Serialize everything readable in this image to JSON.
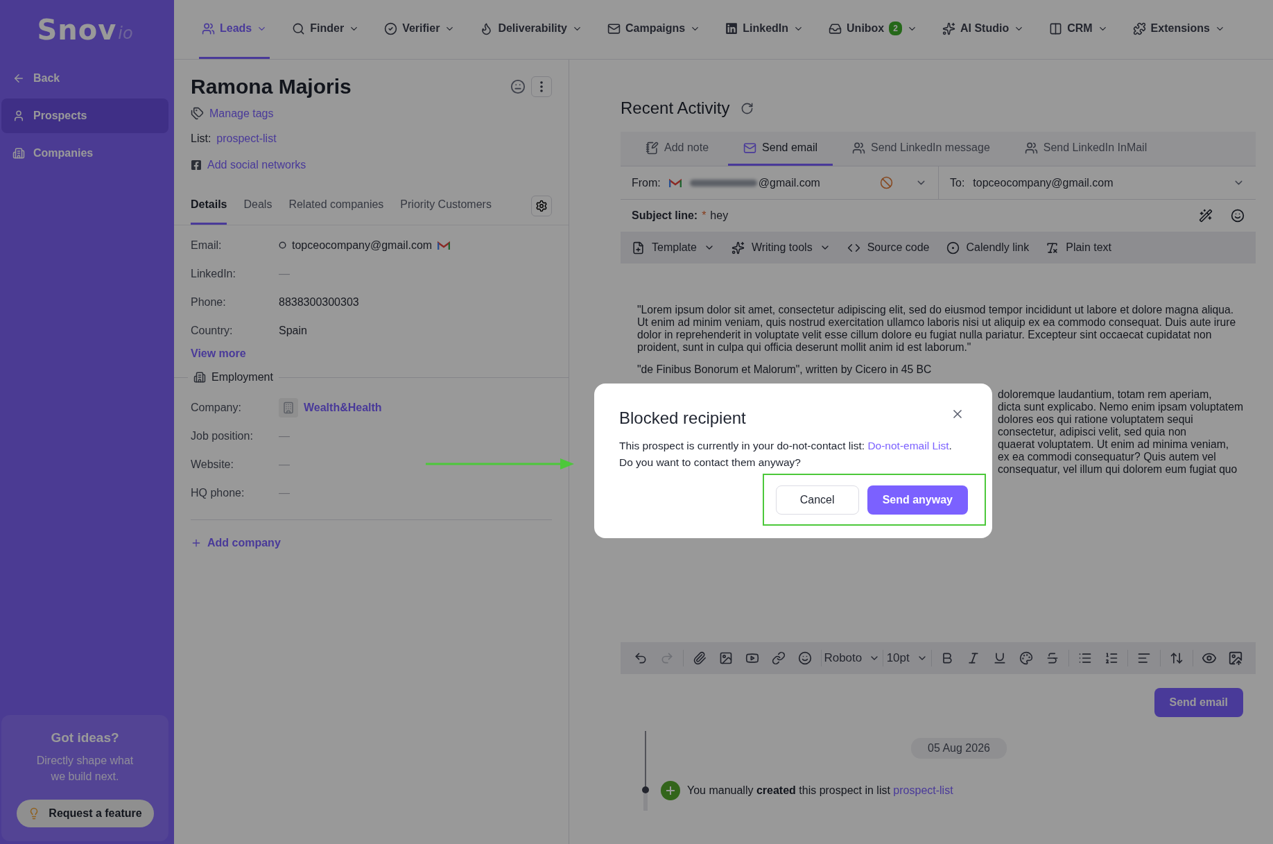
{
  "sidebar": {
    "logo": {
      "name": "Snov",
      "suffix": "io"
    },
    "items": [
      {
        "label": "Back",
        "kind": "back",
        "selected": false
      },
      {
        "label": "Prospects",
        "kind": "prospects",
        "selected": true
      },
      {
        "label": "Companies",
        "kind": "companies",
        "selected": false
      }
    ],
    "promo": {
      "title": "Got ideas?",
      "text": "Directly shape what we build next.",
      "button": "Request a feature"
    }
  },
  "top_nav": [
    {
      "label": "Leads",
      "selected": true
    },
    {
      "label": "Finder",
      "selected": false
    },
    {
      "label": "Verifier",
      "selected": false
    },
    {
      "label": "Deliverability",
      "selected": false
    },
    {
      "label": "Campaigns",
      "selected": false
    },
    {
      "label": "LinkedIn",
      "selected": false
    },
    {
      "label": "Unibox",
      "selected": false,
      "badge": "2"
    },
    {
      "label": "AI Studio",
      "selected": false
    },
    {
      "label": "CRM",
      "selected": false
    },
    {
      "label": "Extensions",
      "selected": false
    }
  ],
  "prospect": {
    "name": "Ramona Majoris",
    "manage_tags": "Manage tags",
    "list_label": "List:",
    "list_value": "prospect-list",
    "add_social": "Add social networks",
    "tabs": [
      {
        "label": "Details",
        "selected": true
      },
      {
        "label": "Deals",
        "selected": false
      },
      {
        "label": "Related companies",
        "selected": false
      },
      {
        "label": "Priority Customers",
        "selected": false
      }
    ],
    "fields": [
      {
        "label": "Email:",
        "value": "topceocompany@gmail.com",
        "kind": "email"
      },
      {
        "label": "LinkedIn:",
        "value": "—",
        "kind": "empty"
      },
      {
        "label": "Phone:",
        "value": "8838300300303",
        "kind": "text"
      },
      {
        "label": "Country:",
        "value": "Spain",
        "kind": "text"
      }
    ],
    "view_more": "View more",
    "employment": {
      "title": "Employment",
      "fields": [
        {
          "label": "Company:",
          "value": "Wealth&Health",
          "kind": "company"
        },
        {
          "label": "Job position:",
          "value": "—",
          "kind": "empty"
        },
        {
          "label": "Website:",
          "value": "—",
          "kind": "empty"
        },
        {
          "label": "HQ phone:",
          "value": "—",
          "kind": "empty"
        }
      ]
    },
    "add_company": "Add company"
  },
  "activity": {
    "title": "Recent Activity",
    "tabs": [
      {
        "label": "Add note",
        "selected": false
      },
      {
        "label": "Send email",
        "selected": true
      },
      {
        "label": "Send LinkedIn message",
        "selected": false
      },
      {
        "label": "Send LinkedIn InMail",
        "selected": false
      }
    ],
    "from_label": "From:",
    "from_value": "@gmail.com",
    "to_label": "To:",
    "to_value": "topceocompany@gmail.com",
    "subject_label": "Subject line:",
    "subject_required": "*",
    "subject_value": "hey",
    "tools": [
      "Template",
      "Writing tools",
      "Source code",
      "Calendly link",
      "Plain text"
    ],
    "body": [
      "\"Lorem ipsum dolor sit amet, consectetur adipiscing elit, sed do eiusmod tempor incididunt ut labore et dolore magna aliqua. Ut enim ad minim veniam, quis nostrud exercitation ullamco laboris nisi ut aliquip ex ea commodo consequat. Duis aute irure dolor in reprehenderit in voluptate velit esse cillum dolore eu fugiat nulla pariatur. Excepteur sint occaecat cupidatat non proident, sunt in culpa qui officia deserunt mollit anim id est laborum.\"",
      "\"de Finibus Bonorum et Malorum\", written by Cicero in 45 BC"
    ],
    "body_partial_lines": [
      "doloremque laudantium, totam rem aperiam,",
      "dicta sunt explicabo. Nemo enim ipsam voluptatem",
      "dolores eos qui ratione voluptatem sequi",
      "consectetur, adipisci velit, sed quia non",
      "quaerat voluptatem. Ut enim ad minima veniam,",
      "ex ea commodi consequatur? Quis autem vel",
      "consequatur, vel illum qui dolorem eum fugiat quo"
    ],
    "font": "Roboto",
    "size": "10pt",
    "redo_disabled": true,
    "send_button": "Send email",
    "date": "05 Aug 2026",
    "event": "You manually **created** this prospect in list",
    "event_link": "prospect-list"
  },
  "modal": {
    "title": "Blocked recipient",
    "text": "This prospect is currently in your do-not-contact list:",
    "link": "Do-not-email List",
    "link_after": ".",
    "question": "Do you want to contact them anyway?",
    "cancel": "Cancel",
    "confirm": "Send anyway"
  }
}
